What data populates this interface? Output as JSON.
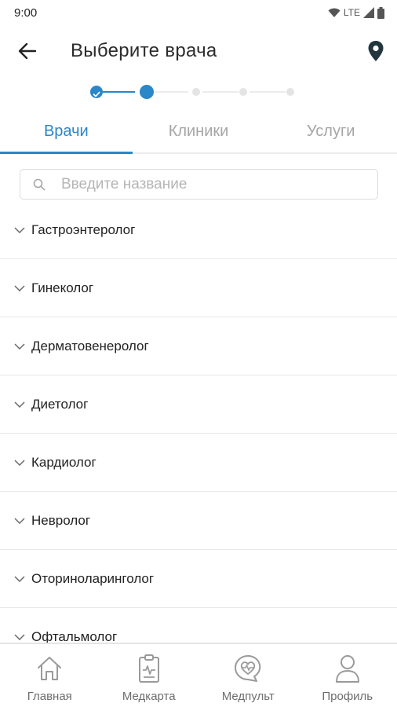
{
  "status_bar": {
    "time": "9:00",
    "network": "LTE",
    "icons": [
      "wifi-icon",
      "signal-icon",
      "battery-icon"
    ]
  },
  "header": {
    "title": "Выберите врача",
    "back_icon": "arrow-left-icon",
    "location_icon": "map-pin-icon"
  },
  "stepper": {
    "total_steps": 5,
    "current_step": 2,
    "completed_steps": 1
  },
  "tabs": [
    {
      "label": "Врачи",
      "active": true
    },
    {
      "label": "Клиники",
      "active": false
    },
    {
      "label": "Услуги",
      "active": false
    }
  ],
  "search": {
    "placeholder": "Введите название",
    "value": ""
  },
  "specialties": [
    {
      "label": "Гастроэнтеролог"
    },
    {
      "label": "Гинеколог"
    },
    {
      "label": "Дерматовенеролог"
    },
    {
      "label": "Диетолог"
    },
    {
      "label": "Кардиолог"
    },
    {
      "label": "Невролог"
    },
    {
      "label": "Оториноларинголог"
    },
    {
      "label": "Офтальмолог"
    }
  ],
  "bottom_nav": [
    {
      "label": "Главная",
      "icon": "home-icon"
    },
    {
      "label": "Медкарта",
      "icon": "medical-record-icon"
    },
    {
      "label": "Медпульт",
      "icon": "heart-chat-icon"
    },
    {
      "label": "Профиль",
      "icon": "profile-icon"
    }
  ],
  "colors": {
    "accent": "#2a87c8",
    "inactive_tab": "#a5a5a5",
    "divider": "#e8e8e8",
    "nav_icon": "#9a9a9a"
  }
}
